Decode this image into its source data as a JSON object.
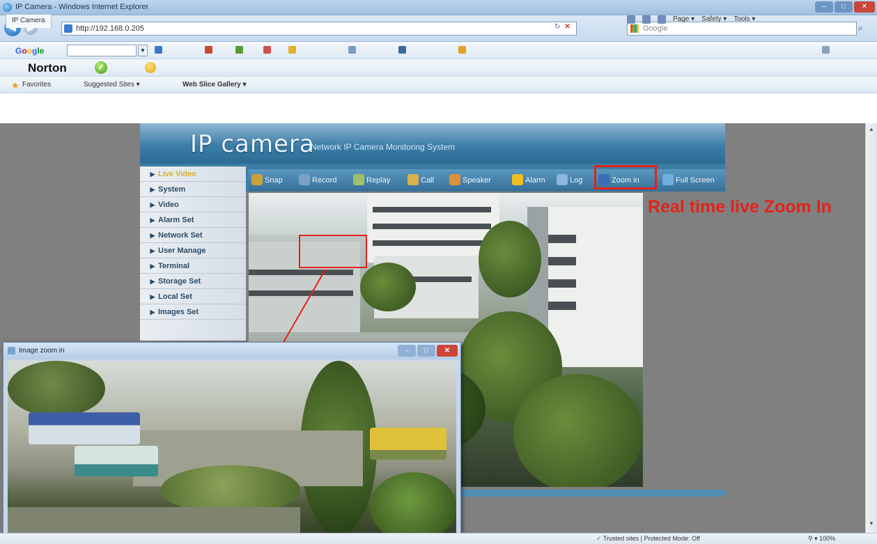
{
  "window": {
    "title": "IP Camera - Windows Internet Explorer",
    "minimize": "–",
    "maximize": "□",
    "close": "✕"
  },
  "addressbar": {
    "url": "http://192.168.0.205",
    "search_placeholder": "Google",
    "back": "◀",
    "forward": "▶",
    "refresh": "↻",
    "stop": "✕",
    "search_go": "⌕"
  },
  "google_toolbar": {
    "logo": [
      "G",
      "o",
      "o",
      "g",
      "le"
    ],
    "dropdown": "▼"
  },
  "norton_toolbar": {
    "label": "Norton",
    "check": "✓"
  },
  "favorites_bar": {
    "favorites": "Favorites",
    "suggested": "Suggested Sites ▾",
    "web_slice": "Web Slice Gallery ▾"
  },
  "tabs": [
    {
      "label": "IP Camera"
    }
  ],
  "command_bar": {
    "page": "Page ▾",
    "safety": "Safety ▾",
    "tools": "Tools ▾"
  },
  "camera_app": {
    "logo": "IP camera",
    "subtitle": "Network IP Camera Monitoring System",
    "menu": [
      "Live Video",
      "System",
      "Video",
      "Alarm Set",
      "Network Set",
      "User Manage",
      "Terminal",
      "Storage Set",
      "Local Set",
      "Images Set"
    ],
    "toolbar": [
      {
        "label": "Snap",
        "color": "#c9a23a"
      },
      {
        "label": "Record",
        "color": "#7ba1c9"
      },
      {
        "label": "Replay",
        "color": "#9fbf6a"
      },
      {
        "label": "Call",
        "color": "#d9b24a"
      },
      {
        "label": "Speaker",
        "color": "#e0903a"
      },
      {
        "label": "Alarm",
        "color": "#f0c020"
      },
      {
        "label": "Log",
        "color": "#8ab6e0"
      },
      {
        "label": "Zoom in",
        "color": "#3a6fb8"
      },
      {
        "label": "Full Screen",
        "color": "#6fb0e0"
      }
    ]
  },
  "annotation": {
    "text": "Real time live Zoom In",
    "color": "#e2231a"
  },
  "zoom_window": {
    "title": "Image zoom in",
    "minimize": "–",
    "maximize": "□",
    "close": "✕"
  },
  "statusbar": {
    "security": "Trusted sites | Protected Mode: Off",
    "zoom": "100%"
  },
  "icons": [
    "ie-logo-icon",
    "back-icon",
    "forward-icon",
    "refresh-icon",
    "stop-icon",
    "bing-icon",
    "star-icon",
    "norton-check-icon",
    "camera-icon",
    "close-icon"
  ]
}
